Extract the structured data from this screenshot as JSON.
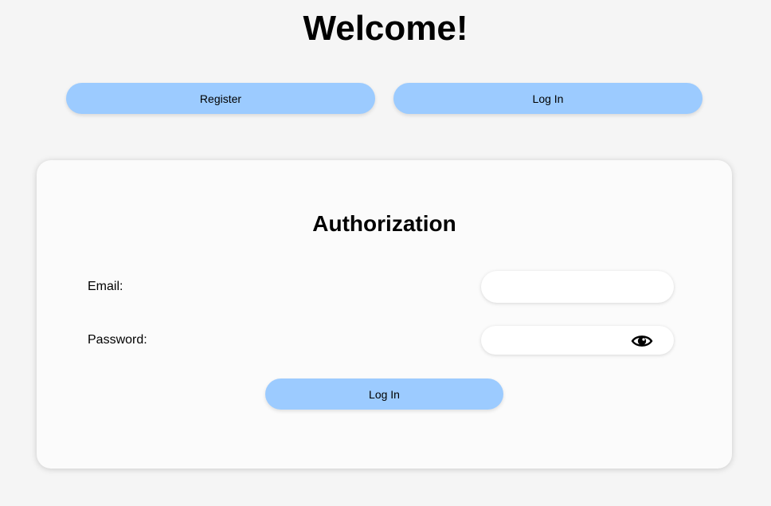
{
  "header": {
    "title": "Welcome!"
  },
  "nav": {
    "register_label": "Register",
    "login_label": "Log In"
  },
  "auth_form": {
    "title": "Authorization",
    "email_label": "Email:",
    "email_value": "",
    "password_label": "Password:",
    "password_value": "",
    "password_toggle_icon": "eye-icon",
    "submit_label": "Log In"
  },
  "colors": {
    "background": "#f5f5f5",
    "card": "#fbfbfb",
    "button": "#9ccbff",
    "text": "#000000"
  }
}
